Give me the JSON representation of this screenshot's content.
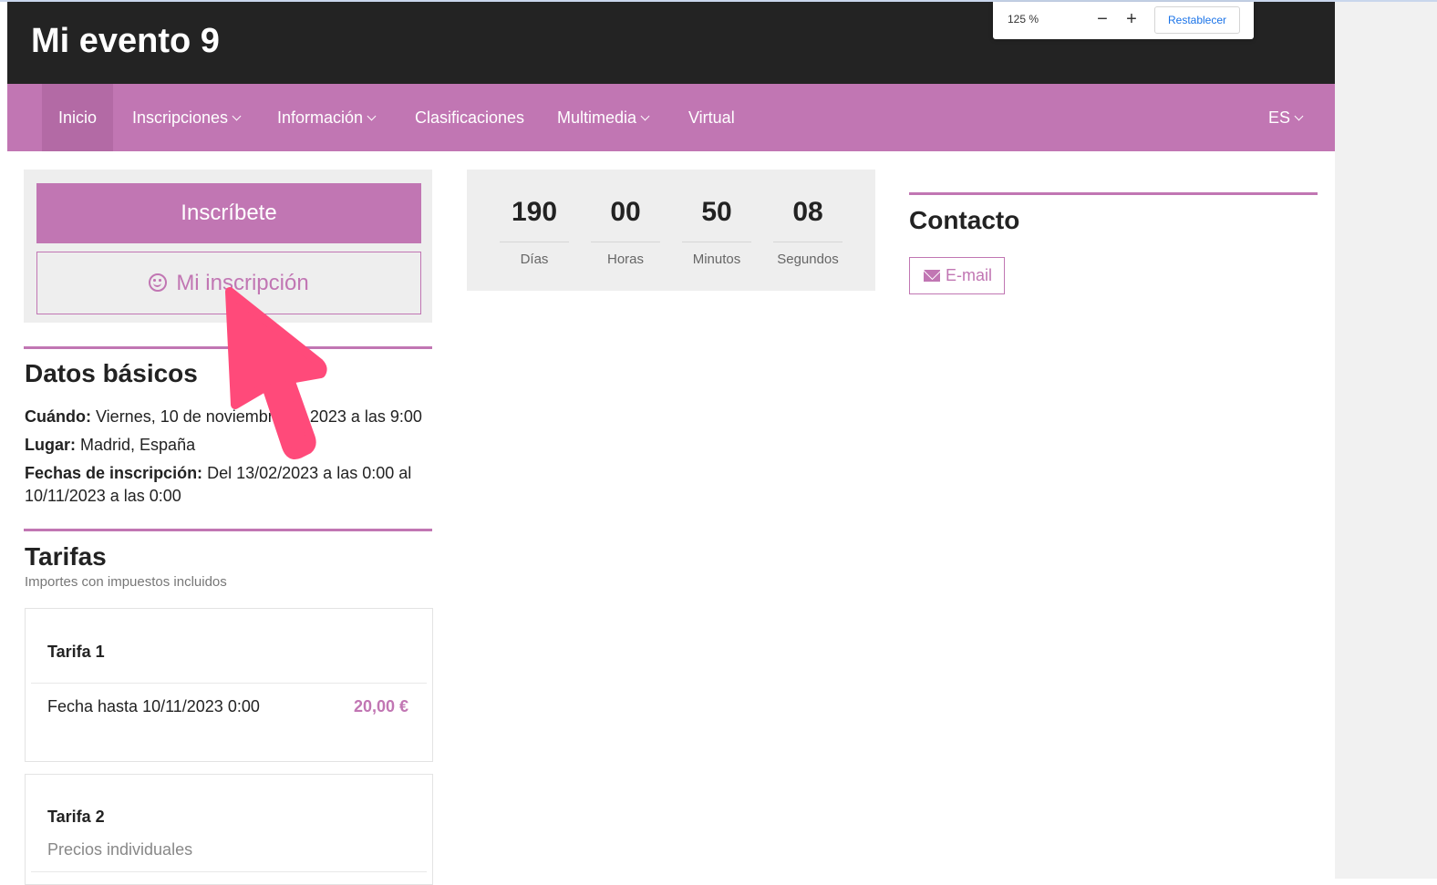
{
  "site": {
    "title": "Mi evento 9"
  },
  "nav": {
    "items": [
      {
        "label": "Inicio"
      },
      {
        "label": "Inscripciones"
      },
      {
        "label": "Información"
      },
      {
        "label": "Clasificaciones"
      },
      {
        "label": "Multimedia"
      },
      {
        "label": "Virtual"
      }
    ],
    "language": "ES"
  },
  "zoom": {
    "level": "125 %",
    "minus": "−",
    "plus": "+",
    "reset": "Restablecer"
  },
  "registration": {
    "primary": "Inscríbete",
    "secondary": "Mi inscripción"
  },
  "basics": {
    "title": "Datos básicos",
    "when_label": "Cuándo:",
    "when_value": "Viernes, 10 de noviembre de 2023 a las 9:00",
    "where_label": "Lugar:",
    "where_value": "Madrid, España",
    "dates_label": "Fechas de inscripción:",
    "dates_value": "Del 13/02/2023 a las 0:00 al 10/11/2023 a las 0:00"
  },
  "tariffs": {
    "title": "Tarifas",
    "subtitle": "Importes con impuestos incluidos",
    "items": [
      {
        "name": "Tarifa 1",
        "date": "Fecha hasta 10/11/2023 0:00",
        "price": "20,00 €"
      },
      {
        "name": "Tarifa 2",
        "note": "Precios individuales"
      }
    ]
  },
  "countdown": {
    "cells": [
      {
        "value": "190",
        "label": "Días"
      },
      {
        "value": "00",
        "label": "Horas"
      },
      {
        "value": "50",
        "label": "Minutos"
      },
      {
        "value": "08",
        "label": "Segundos"
      }
    ]
  },
  "contact": {
    "title": "Contacto",
    "email": "E-mail"
  },
  "colors": {
    "accent": "#c176b3",
    "header": "#232323",
    "panel": "#eeeeee",
    "pointer": "#ff4a7a"
  },
  "icons": [
    "chevron-down-icon",
    "smiley-icon",
    "envelope-icon",
    "pointer-arrow-icon"
  ]
}
